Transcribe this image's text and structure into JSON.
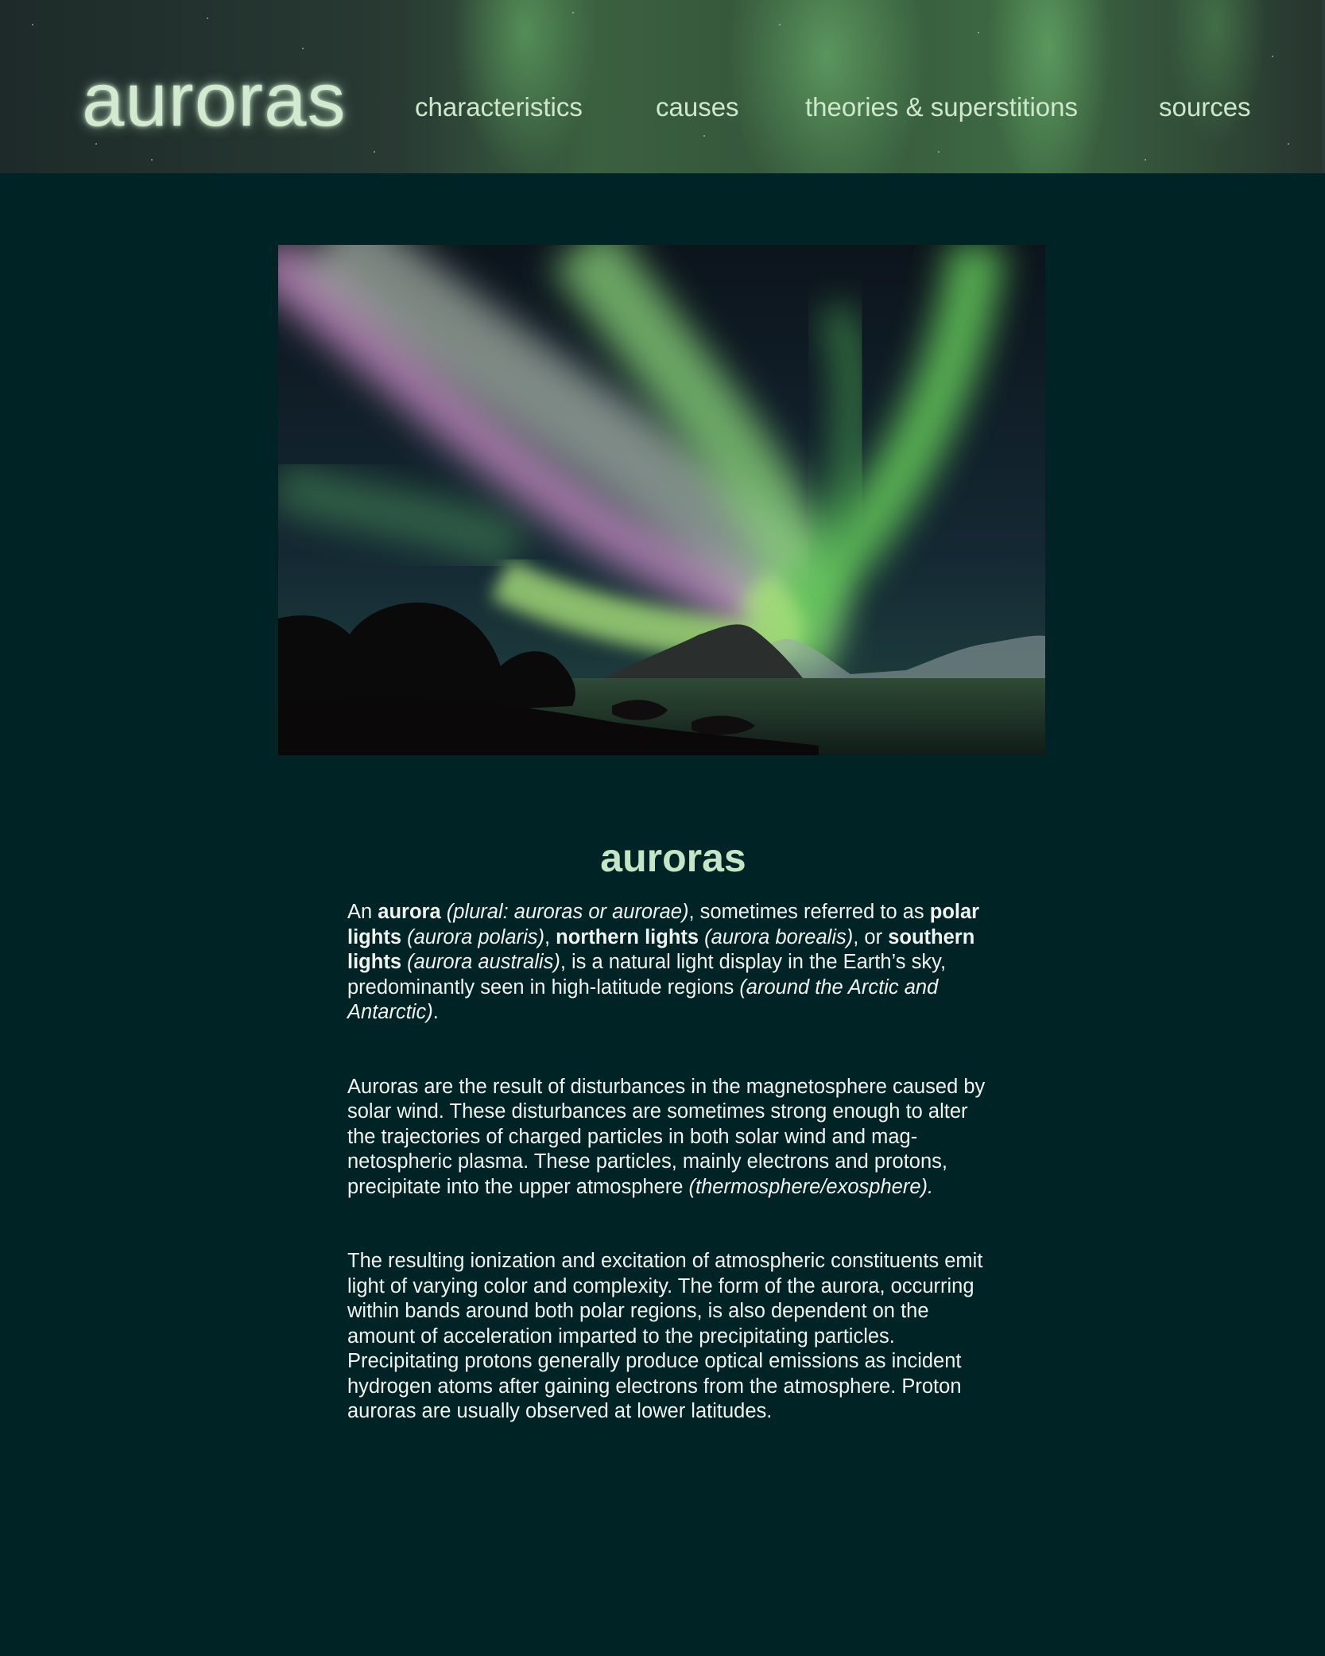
{
  "site": {
    "logo": "auroras",
    "nav": [
      "characteristics",
      "causes",
      "theories & superstitions",
      "sources"
    ]
  },
  "hero": {
    "icon": "aurora-photo"
  },
  "article": {
    "title": "auroras",
    "p1": {
      "s1": "An ",
      "b1": "aurora",
      "i1": " (plural: auroras or aurorae)",
      "s2": ", sometimes referred to as ",
      "b2": "polar lights",
      "i2": " (aurora polaris)",
      "s3": ", ",
      "b3": "northern lights",
      "i3": " (aurora borealis)",
      "s4": ", or ",
      "b4": "southern lights",
      "i4": " (aurora australis)",
      "s5": ", is a natural light display in the Earth’s sky, predominantly seen in high-latitude regions ",
      "i5": "(around the Arctic and Antarctic)",
      "s6": "."
    },
    "p2": {
      "s1": "Auroras are the result of disturbances in the magnetosphere caused by solar wind. These disturbances are sometimes strong enough to alter the trajectories of charged particles in both solar wind and mag-netospheric plasma. These particles, mainly electrons and protons, precipitate into the upper atmosphere ",
      "i1": "(thermosphere/exosphere)."
    },
    "p3": "The resulting ionization and excitation of atmospheric constituents emit light of varying color and complexity. The form of the aurora, occurring within bands around both polar regions, is also dependent on the amount of acceleration imparted to the precipitating particles. Precipitating protons generally produce optical emissions as incident hydrogen atoms after gaining electrons from the atmosphere. Proton auroras are usually observed at lower latitudes."
  },
  "colors": {
    "background": "#002426",
    "logo": "#d3ead1",
    "nav": "#cfe8cc",
    "title": "#c5e6c6",
    "text": "#f1f3f0"
  }
}
